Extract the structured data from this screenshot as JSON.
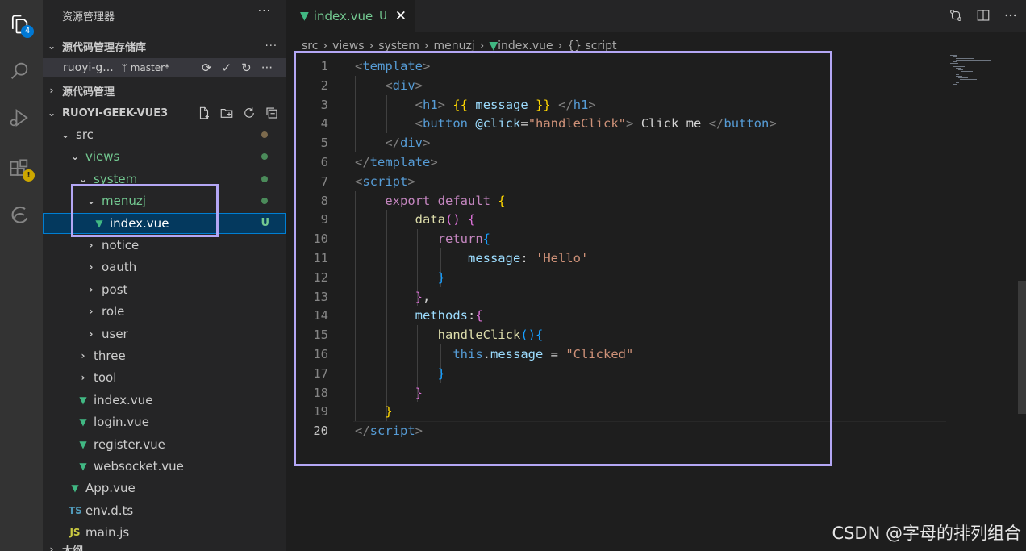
{
  "activity_bar": {
    "explorer_badge": "4",
    "extensions_badge": "!"
  },
  "sidebar": {
    "title": "资源管理器",
    "more": "···",
    "scm_section": {
      "title": "源代码管理存储库",
      "more": "···"
    },
    "scm_repo": {
      "name": "ruoyi-g...",
      "branch": "master*"
    },
    "scm_section2": {
      "title": "源代码管理"
    },
    "explorer_section": {
      "title": "RUOYI-GEEK-VUE3"
    },
    "tree": [
      {
        "label": "src",
        "type": "folder-open",
        "indent": 1,
        "dot": "#7c6a4d"
      },
      {
        "label": "views",
        "type": "folder-open",
        "indent": 2,
        "dot": "#4b8b5a",
        "green": true
      },
      {
        "label": "system",
        "type": "folder-open",
        "indent": 3,
        "dot": "#4b8b5a",
        "green": true
      },
      {
        "label": "menuzj",
        "type": "folder-open",
        "indent": 4,
        "dot": "#4b8b5a",
        "green": true
      },
      {
        "label": "index.vue",
        "type": "vue",
        "indent": 5,
        "status": "U",
        "selected": true
      },
      {
        "label": "notice",
        "type": "folder",
        "indent": 4
      },
      {
        "label": "oauth",
        "type": "folder",
        "indent": 4
      },
      {
        "label": "post",
        "type": "folder",
        "indent": 4
      },
      {
        "label": "role",
        "type": "folder",
        "indent": 4
      },
      {
        "label": "user",
        "type": "folder",
        "indent": 4
      },
      {
        "label": "three",
        "type": "folder",
        "indent": 3
      },
      {
        "label": "tool",
        "type": "folder",
        "indent": 3
      },
      {
        "label": "index.vue",
        "type": "vue",
        "indent": 3
      },
      {
        "label": "login.vue",
        "type": "vue",
        "indent": 3
      },
      {
        "label": "register.vue",
        "type": "vue",
        "indent": 3
      },
      {
        "label": "websocket.vue",
        "type": "vue",
        "indent": 3
      },
      {
        "label": "App.vue",
        "type": "vue",
        "indent": 2
      },
      {
        "label": "env.d.ts",
        "type": "ts",
        "indent": 2
      },
      {
        "label": "main.js",
        "type": "js",
        "indent": 2
      }
    ],
    "outline_section": {
      "title": "大纲"
    }
  },
  "tab": {
    "label": "index.vue",
    "status": "U",
    "close": "✕"
  },
  "breadcrumbs": [
    "src",
    "views",
    "system",
    "menuzj",
    "index.vue",
    "{} script"
  ],
  "editor": {
    "current_line": 20,
    "lines": [
      [
        [
          "t-br",
          "<"
        ],
        [
          "t-tag",
          "template"
        ],
        [
          "t-br",
          ">"
        ]
      ],
      [
        [
          "t-txt",
          "    "
        ],
        [
          "t-br",
          "<"
        ],
        [
          "t-tag",
          "div"
        ],
        [
          "t-br",
          ">"
        ]
      ],
      [
        [
          "t-txt",
          "        "
        ],
        [
          "t-br",
          "<"
        ],
        [
          "t-tag",
          "h1"
        ],
        [
          "t-br",
          ">"
        ],
        [
          "t-txt",
          " "
        ],
        [
          "t-y",
          "{{"
        ],
        [
          "t-txt",
          " "
        ],
        [
          "t-var",
          "message"
        ],
        [
          "t-txt",
          " "
        ],
        [
          "t-y",
          "}}"
        ],
        [
          "t-txt",
          " "
        ],
        [
          "t-br",
          "</"
        ],
        [
          "t-tag",
          "h1"
        ],
        [
          "t-br",
          ">"
        ]
      ],
      [
        [
          "t-txt",
          "        "
        ],
        [
          "t-br",
          "<"
        ],
        [
          "t-tag",
          "button"
        ],
        [
          "t-txt",
          " "
        ],
        [
          "t-var",
          "@click"
        ],
        [
          "t-txt",
          "="
        ],
        [
          "t-str",
          "\"handleClick\""
        ],
        [
          "t-br",
          ">"
        ],
        [
          "t-txt",
          " Click me "
        ],
        [
          "t-br",
          "</"
        ],
        [
          "t-tag",
          "button"
        ],
        [
          "t-br",
          ">"
        ]
      ],
      [
        [
          "t-txt",
          "    "
        ],
        [
          "t-br",
          "</"
        ],
        [
          "t-tag",
          "div"
        ],
        [
          "t-br",
          ">"
        ]
      ],
      [
        [
          "t-br",
          "</"
        ],
        [
          "t-tag",
          "template"
        ],
        [
          "t-br",
          ">"
        ]
      ],
      [
        [
          "t-br",
          "<"
        ],
        [
          "t-tag",
          "script"
        ],
        [
          "t-br",
          ">"
        ]
      ],
      [
        [
          "t-txt",
          "    "
        ],
        [
          "t-kw",
          "export"
        ],
        [
          "t-txt",
          " "
        ],
        [
          "t-kw",
          "default"
        ],
        [
          "t-txt",
          " "
        ],
        [
          "t-y",
          "{"
        ]
      ],
      [
        [
          "t-txt",
          "        "
        ],
        [
          "t-fn",
          "data"
        ],
        [
          "t-p",
          "()"
        ],
        [
          "t-txt",
          " "
        ],
        [
          "t-p",
          "{"
        ]
      ],
      [
        [
          "t-txt",
          "           "
        ],
        [
          "t-kw",
          "return"
        ],
        [
          "t-b",
          "{"
        ]
      ],
      [
        [
          "t-txt",
          "               "
        ],
        [
          "t-var",
          "message"
        ],
        [
          "t-txt",
          ": "
        ],
        [
          "t-str",
          "'Hello'"
        ]
      ],
      [
        [
          "t-txt",
          "           "
        ],
        [
          "t-b",
          "}"
        ]
      ],
      [
        [
          "t-txt",
          "        "
        ],
        [
          "t-p",
          "}"
        ],
        [
          "t-txt",
          ","
        ]
      ],
      [
        [
          "t-txt",
          "        "
        ],
        [
          "t-var",
          "methods"
        ],
        [
          "t-txt",
          ":"
        ],
        [
          "t-p",
          "{"
        ]
      ],
      [
        [
          "t-txt",
          "           "
        ],
        [
          "t-fn",
          "handleClick"
        ],
        [
          "t-b",
          "(){"
        ]
      ],
      [
        [
          "t-txt",
          "             "
        ],
        [
          "t-kw2",
          "this"
        ],
        [
          "t-txt",
          "."
        ],
        [
          "t-var",
          "message"
        ],
        [
          "t-txt",
          " = "
        ],
        [
          "t-str",
          "\"Clicked\""
        ]
      ],
      [
        [
          "t-txt",
          "           "
        ],
        [
          "t-b",
          "}"
        ]
      ],
      [
        [
          "t-txt",
          "        "
        ],
        [
          "t-p",
          "}"
        ]
      ],
      [
        [
          "t-txt",
          "    "
        ],
        [
          "t-y",
          "}"
        ]
      ],
      [
        [
          "t-br",
          "</"
        ],
        [
          "t-tag",
          "script"
        ],
        [
          "t-br",
          ">"
        ]
      ]
    ]
  },
  "watermark": "CSDN @字母的排列组合",
  "colors": {
    "highlight_box": "#b4a7f5",
    "git_untracked": "#73c991",
    "selection": "#04395e"
  }
}
